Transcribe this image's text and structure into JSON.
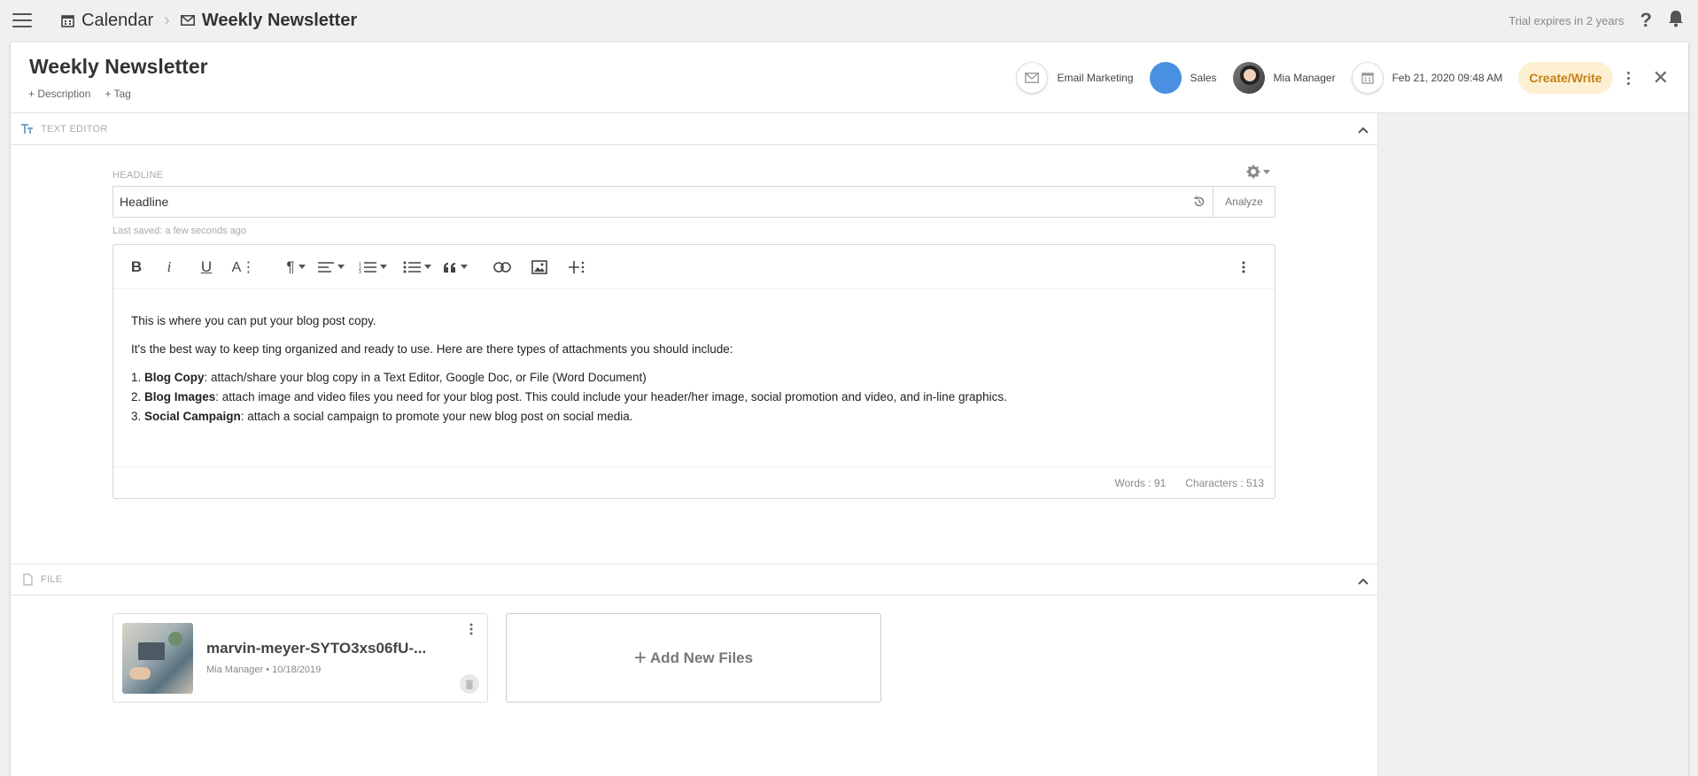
{
  "breadcrumb": {
    "calendar": "Calendar",
    "newsletter": "Weekly Newsletter"
  },
  "topbar": {
    "trial": "Trial expires in 2 years"
  },
  "header": {
    "title": "Weekly Newsletter",
    "description_link": "+ Description",
    "tag_link": "+ Tag",
    "channel": "Email Marketing",
    "team": "Sales",
    "owner": "Mia Manager",
    "date": "Feb 21, 2020 09:48 AM",
    "cta": "Create/Write",
    "team_color": "#4a90e2",
    "cta_color": "#c47f17"
  },
  "text_editor": {
    "section_label": "TEXT EDITOR",
    "headline_label": "HEADLINE",
    "headline_value": "Headline",
    "analyze": "Analyze",
    "saved": "Last saved: a few seconds ago",
    "p1": "This is where you can put your blog post copy.",
    "p2": "It's the best way to keep ting organized and ready to use. Here are there types of attachments you should include:",
    "items": [
      {
        "num": "1. ",
        "bold": "Blog Copy",
        "text": ": attach/share your blog copy in a Text Editor, Google Doc, or File (Word Document)"
      },
      {
        "num": "2. ",
        "bold": "Blog Images",
        "text": ": attach image and video files you need for your blog post. This could include your header/her image, social promotion and video, and in-line graphics."
      },
      {
        "num": "3. ",
        "bold": "Social Campaign",
        "text": ": attach a social campaign to promote your new blog post on social media."
      }
    ],
    "words": "Words : 91",
    "characters": "Characters : 513"
  },
  "file_section": {
    "section_label": "FILE",
    "file_name": "marvin-meyer-SYTO3xs06fU-...",
    "file_meta": "Mia Manager • 10/18/2019",
    "add_files": "Add New Files"
  }
}
